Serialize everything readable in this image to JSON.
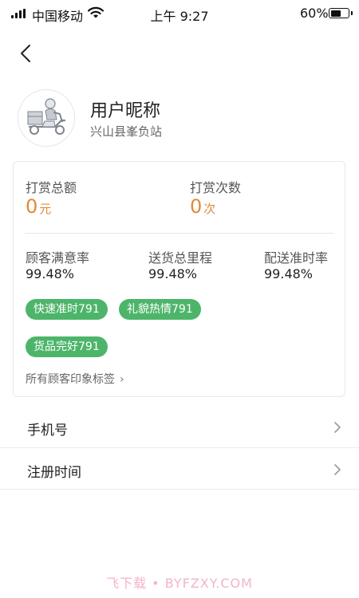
{
  "status_bar": {
    "carrier": "中国移动",
    "time": "上午 9:27",
    "battery_percent": "60%",
    "battery_level": 0.6
  },
  "profile": {
    "nickname": "用户昵称",
    "station": "兴山县峯负站"
  },
  "rewards": {
    "total_amount_label": "打赏总额",
    "total_amount_value": "0",
    "total_amount_unit": "元",
    "count_label": "打赏次数",
    "count_value": "0",
    "count_unit": "次"
  },
  "metrics": [
    {
      "label": "顾客满意率",
      "value": "99.48%"
    },
    {
      "label": "送货总里程",
      "value": "99.48%"
    },
    {
      "label": "配送准时率",
      "value": "99.48%"
    }
  ],
  "tags": [
    "快速准时791",
    "礼貌热情791",
    "货品完好791"
  ],
  "all_tags_link": "所有顾客印象标签",
  "list": [
    {
      "label": "手机号"
    },
    {
      "label": "注册时间"
    }
  ],
  "watermark": "飞下载 • BYFZXY.COM",
  "colors": {
    "accent_orange": "#e08a3c",
    "tag_green": "#4db56a"
  }
}
